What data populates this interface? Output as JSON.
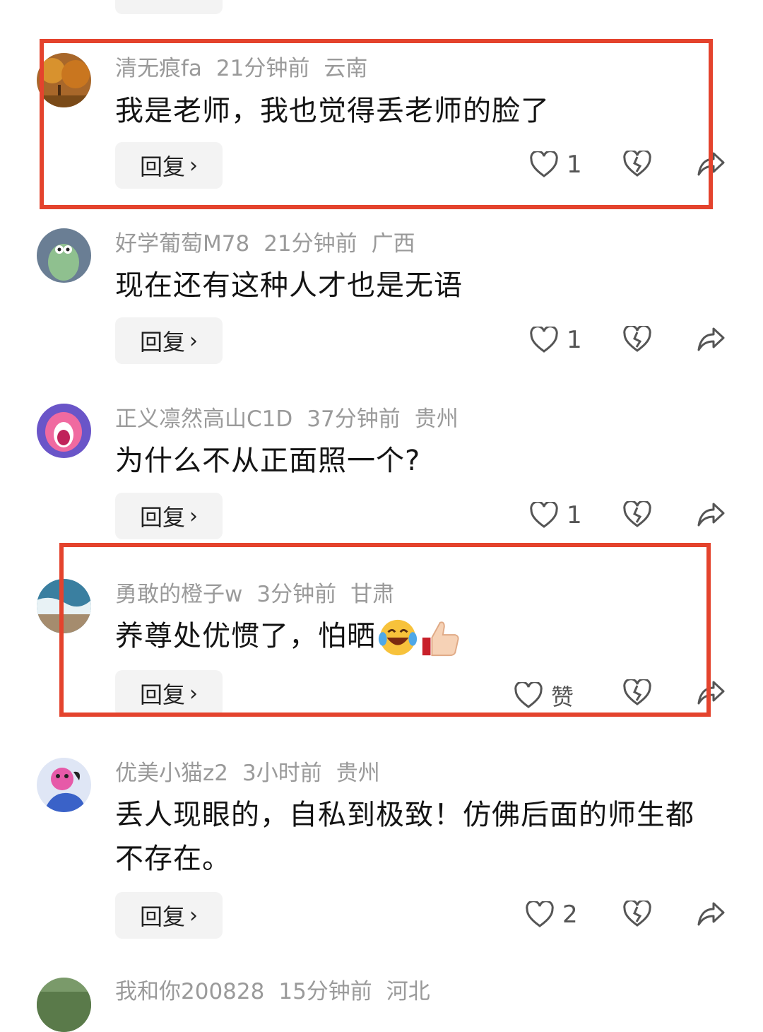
{
  "comments": [
    {
      "user": "清无痕fa",
      "time": "21分钟前",
      "location": "云南",
      "text": "我是老师，我也觉得丢老师的脸了",
      "reply_label": "回复",
      "like_count": "1"
    },
    {
      "user": "好学葡萄M78",
      "time": "21分钟前",
      "location": "广西",
      "text": "现在还有这种人才也是无语",
      "reply_label": "回复",
      "like_count": "1"
    },
    {
      "user": "正义凛然高山C1D",
      "time": "37分钟前",
      "location": "贵州",
      "text": "为什么不从正面照一个?",
      "reply_label": "回复",
      "like_count": "1"
    },
    {
      "user": "勇敢的橙子w",
      "time": "3分钟前",
      "location": "甘肃",
      "text": "养尊处优惯了，怕晒",
      "emoji": [
        "laughing-tears-emoji",
        "thumbs-up-emoji"
      ],
      "reply_label": "回复",
      "like_count": "赞"
    },
    {
      "user": "优美小猫z2",
      "time": "3小时前",
      "location": "贵州",
      "text": "丢人现眼的，自私到极致！仿佛后面的师生都不存在。",
      "reply_label": "回复",
      "like_count": "2"
    },
    {
      "user": "我和你200828",
      "time": "15分钟前",
      "location": "河北"
    }
  ],
  "icons": {
    "like": "heart-outline-icon",
    "dislike": "broken-heart-icon",
    "share": "share-arrow-icon",
    "chevron": "chevron-right-icon"
  },
  "colors": {
    "highlight": "#e4432d",
    "meta": "#9a9a9a",
    "reply_bg": "#f3f3f3"
  }
}
